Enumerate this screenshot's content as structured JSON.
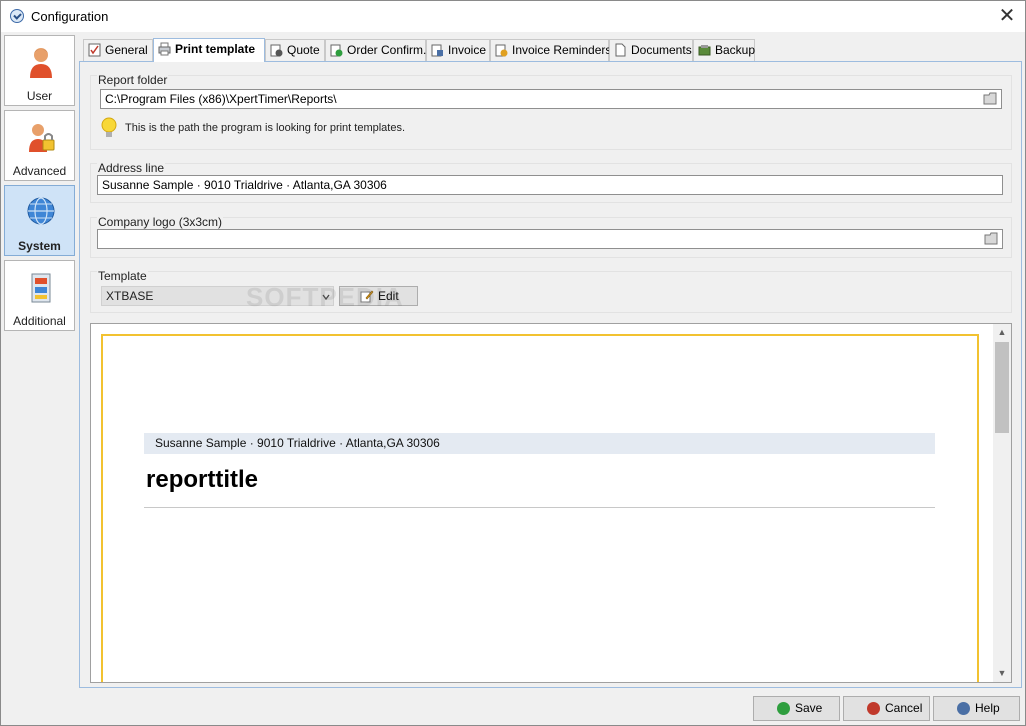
{
  "window": {
    "title": "Configuration"
  },
  "nav": [
    {
      "label": "User",
      "icon": "user-icon"
    },
    {
      "label": "Advanced",
      "icon": "user-lock-icon"
    },
    {
      "label": "System",
      "icon": "globe-icon",
      "active": true
    },
    {
      "label": "Additional",
      "icon": "cabinet-icon"
    }
  ],
  "tabs": [
    {
      "label": "General",
      "icon": "checklist-icon"
    },
    {
      "label": "Print template",
      "icon": "printer-icon",
      "active": true
    },
    {
      "label": "Quote",
      "icon": "quote-icon"
    },
    {
      "label": "Order Confirm.",
      "icon": "order-confirm-icon"
    },
    {
      "label": "Invoice",
      "icon": "invoice-icon"
    },
    {
      "label": "Invoice Reminders",
      "icon": "reminder-icon"
    },
    {
      "label": "Documents",
      "icon": "documents-icon"
    },
    {
      "label": "Backup",
      "icon": "backup-icon"
    }
  ],
  "report_folder": {
    "label": "Report folder",
    "value": "C:\\Program Files (x86)\\XpertTimer\\Reports\\",
    "hint": "This is the path the program is looking for print templates."
  },
  "address_line": {
    "label": "Address line",
    "value": "Susanne Sample · 9010 Trialdrive  · Atlanta,GA 30306"
  },
  "company_logo": {
    "label": "Company logo (3x3cm)",
    "value": ""
  },
  "template": {
    "label": "Template",
    "selected": "XTBASE",
    "edit_label": "Edit"
  },
  "preview": {
    "address": "Susanne Sample · 9010 Trialdrive  · Atlanta,GA 30306",
    "title": "reporttitle"
  },
  "watermark": "SOFTPEDIA",
  "buttons": {
    "save": "Save",
    "cancel": "Cancel",
    "help": "Help"
  },
  "colors": {
    "accent_border": "#f2c230",
    "active_nav": "#cfe3f7",
    "panel_border": "#9dbcdf"
  }
}
